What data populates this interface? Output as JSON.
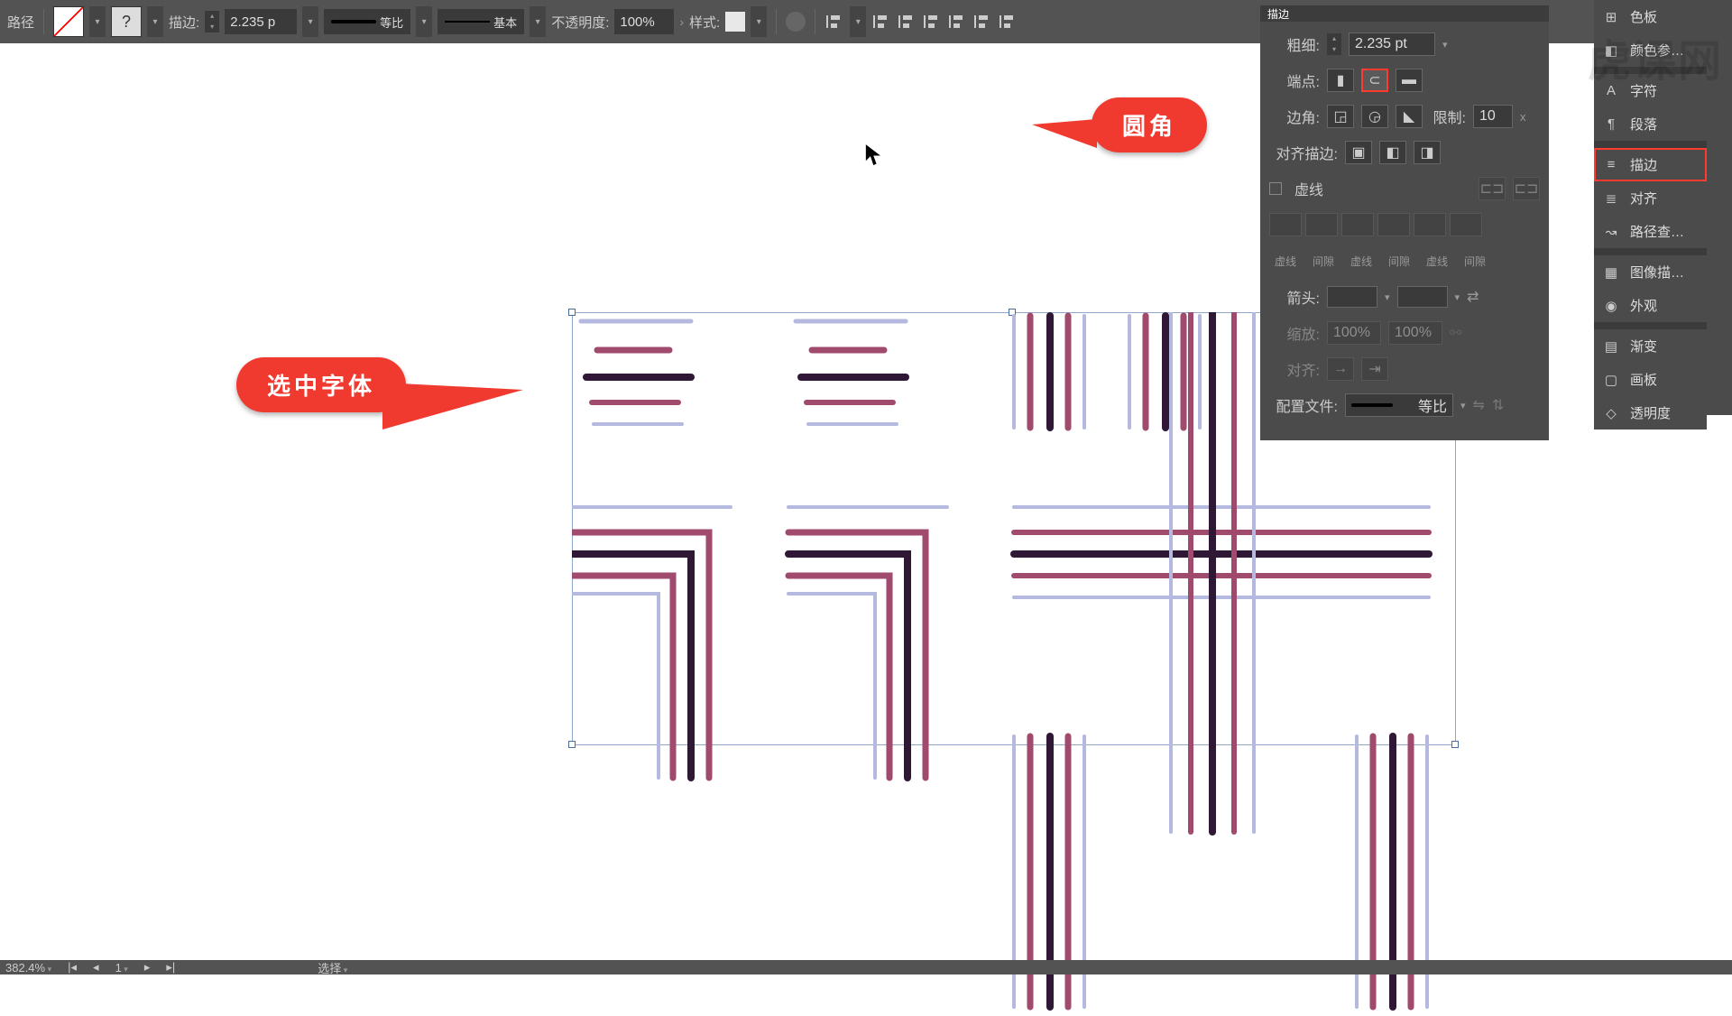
{
  "colors": {
    "accent": "#f03a2f",
    "panel": "#4b4b4b",
    "panel2": "#535353"
  },
  "topbar": {
    "selection_label": "路径",
    "stroke_label": "描边:",
    "stroke_weight": "2.235 p",
    "profile_label": "等比",
    "brush_label": "基本",
    "opacity_label": "不透明度:",
    "opacity_value": "100%",
    "style_label": "样式:"
  },
  "tools": {
    "close": "×",
    "menu": "«"
  },
  "stroke_panel": {
    "tabs": [
      "描边"
    ],
    "weight_label": "粗细:",
    "weight_value": "2.235 pt",
    "cap_label": "端点:",
    "corner_label": "边角:",
    "limit_label": "限制:",
    "limit_value": "10",
    "align_label": "对齐描边:",
    "dashed_label": "虚线",
    "dash_cols": [
      "虚线",
      "间隙",
      "虚线",
      "间隙",
      "虚线",
      "间隙"
    ],
    "arrow_label": "箭头:",
    "scale_label": "缩放:",
    "scale_a": "100%",
    "scale_b": "100%",
    "align2_label": "对齐:",
    "profile_label": "配置文件:",
    "profile_value": "等比",
    "close": "×"
  },
  "right_panels": {
    "items": [
      {
        "icon": "⊞",
        "label": "色板"
      },
      {
        "icon": "◧",
        "label": "颜色参…"
      },
      {
        "icon": "A",
        "label": "字符"
      },
      {
        "icon": "¶",
        "label": "段落"
      },
      {
        "icon": "≡",
        "label": "描边",
        "active": true
      },
      {
        "icon": "≣",
        "label": "对齐"
      },
      {
        "icon": "↝",
        "label": "路径查…"
      },
      {
        "icon": "▦",
        "label": "图像描…"
      },
      {
        "icon": "◉",
        "label": "外观"
      },
      {
        "icon": "▤",
        "label": "渐变"
      },
      {
        "icon": "▢",
        "label": "画板"
      },
      {
        "icon": "◇",
        "label": "透明度"
      }
    ]
  },
  "callouts": {
    "select_font": "选中字体",
    "round_cap": "圆角"
  },
  "status": {
    "zoom": "382.4%",
    "artboard_nav": "1",
    "tool_hint": "选择"
  },
  "watermark": "虎课网"
}
